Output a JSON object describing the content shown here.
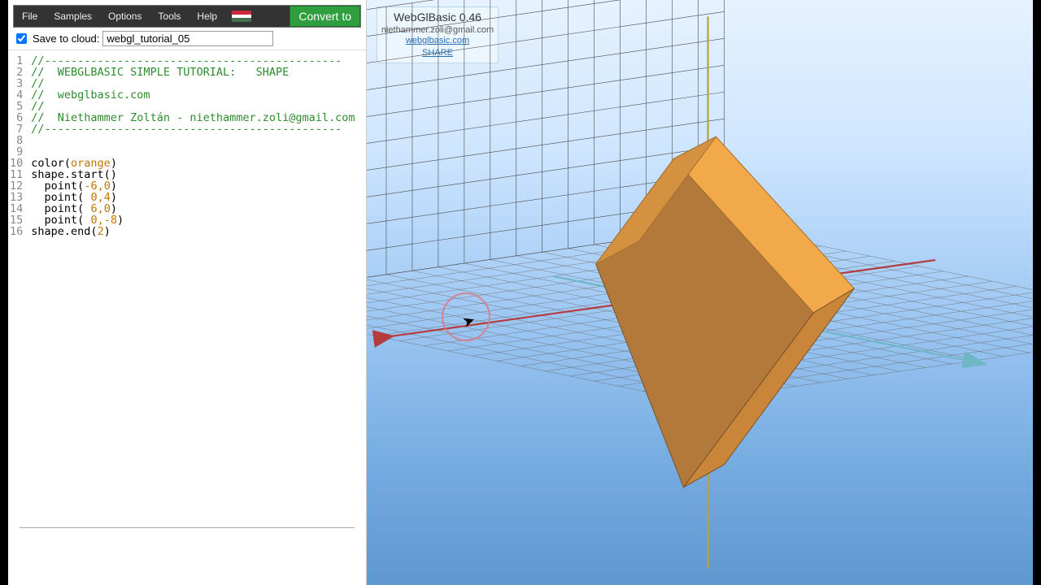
{
  "menubar": {
    "items": [
      "File",
      "Samples",
      "Options",
      "Tools",
      "Help"
    ],
    "convert_label": "Convert to"
  },
  "cloud": {
    "label": "Save to cloud:",
    "filename": "webgl_tutorial_05",
    "checked": true
  },
  "code": {
    "lines": [
      {
        "n": 1,
        "cls": "cmt",
        "text": "//---------------------------------------------"
      },
      {
        "n": 2,
        "cls": "cmt",
        "text": "//  WEBGLBASIC SIMPLE TUTORIAL:   SHAPE"
      },
      {
        "n": 3,
        "cls": "cmt",
        "text": "//"
      },
      {
        "n": 4,
        "cls": "cmt",
        "text": "//  webglbasic.com"
      },
      {
        "n": 5,
        "cls": "cmt",
        "text": "//"
      },
      {
        "n": 6,
        "cls": "cmt",
        "text": "//  Niethammer Zoltán - niethammer.zoli@gmail.com"
      },
      {
        "n": 7,
        "cls": "cmt",
        "text": "//---------------------------------------------"
      },
      {
        "n": 8,
        "cls": "plain",
        "text": ""
      },
      {
        "n": 9,
        "cls": "plain",
        "text": ""
      },
      {
        "n": 10,
        "cls": "code",
        "html": "<span class=fn>color</span>(<span class=arg>orange</span>)"
      },
      {
        "n": 11,
        "cls": "code",
        "html": "<span class=fn>shape.start</span>()"
      },
      {
        "n": 12,
        "cls": "code",
        "html": "  <span class=fn>point</span>(<span class=arg>-6,0</span>)"
      },
      {
        "n": 13,
        "cls": "code",
        "html": "  <span class=fn>point</span>(<span class=arg> 0,4</span>)"
      },
      {
        "n": 14,
        "cls": "code",
        "html": "  <span class=fn>point</span>(<span class=arg> 6,0</span>)"
      },
      {
        "n": 15,
        "cls": "code",
        "html": "  <span class=fn>point</span>(<span class=arg> 0,-8</span>)"
      },
      {
        "n": 16,
        "cls": "code",
        "html": "<span class=fn>shape.end</span>(<span class=arg>2</span>)"
      }
    ]
  },
  "credits": {
    "title": "WebGlBasic 0.46",
    "email": "niethammer.zoli@gmail.com",
    "link1": "webglbasic.com",
    "link2": "SHARE"
  },
  "scene": {
    "accent_top": "#f2a94a",
    "accent_side": "#d49140",
    "accent_front": "#b2793a",
    "axis_x": "#b43c3c",
    "axis_y": "#b7a23a",
    "axis_z": "#6fb7c7"
  }
}
